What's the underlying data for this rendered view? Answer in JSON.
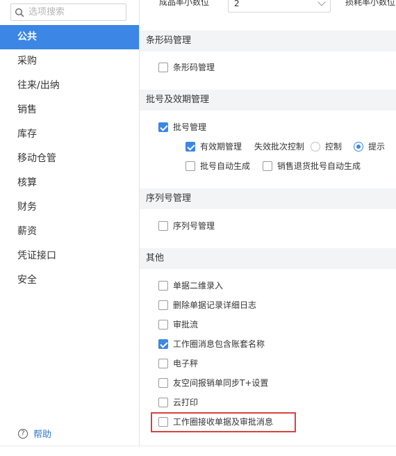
{
  "search": {
    "placeholder": "选项搜索"
  },
  "sidebar": {
    "items": [
      {
        "label": "公共"
      },
      {
        "label": "采购"
      },
      {
        "label": "往来/出纳"
      },
      {
        "label": "销售"
      },
      {
        "label": "库存"
      },
      {
        "label": "移动仓管"
      },
      {
        "label": "核算"
      },
      {
        "label": "财务"
      },
      {
        "label": "薪资"
      },
      {
        "label": "凭证接口"
      },
      {
        "label": "安全"
      }
    ],
    "active": "公共",
    "help_label": "帮助"
  },
  "top_row": {
    "label1": "成品率小数位",
    "select_value": "2",
    "label2": "损耗率小数位"
  },
  "sections": {
    "barcode": {
      "title": "条形码管理",
      "items": [
        {
          "label": "条形码管理",
          "checked": false
        }
      ]
    },
    "batch": {
      "title": "批号及效期管理",
      "batch_mgmt": {
        "label": "批号管理",
        "checked": true
      },
      "expiry": {
        "label": "有效期管理",
        "checked": true
      },
      "expired_ctrl_label": "失效批次控制",
      "radio_control": {
        "label": "控制",
        "checked": false
      },
      "radio_prompt": {
        "label": "提示",
        "checked": true
      },
      "auto_gen": {
        "label": "批号自动生成",
        "checked": false
      },
      "return_auto_gen": {
        "label": "销售退货批号自动生成",
        "checked": false
      }
    },
    "serial": {
      "title": "序列号管理",
      "items": [
        {
          "label": "序列号管理",
          "checked": false
        }
      ]
    },
    "other": {
      "title": "其他",
      "items": [
        {
          "label": "单据二维录入",
          "checked": false
        },
        {
          "label": "删除单据记录详细日志",
          "checked": false
        },
        {
          "label": "审批流",
          "checked": false
        },
        {
          "label": "工作圈消息包含账套名称",
          "checked": true
        },
        {
          "label": "电子秤",
          "checked": false
        },
        {
          "label": "友空间报销单同步T+设置",
          "checked": false
        },
        {
          "label": "云打印",
          "checked": false
        },
        {
          "label": "工作圈接收单据及审批消息",
          "checked": false
        }
      ]
    }
  },
  "colors": {
    "accent": "#3c86e5",
    "highlight": "#d9413c",
    "section_bg": "#f3f4f6"
  },
  "icons": {
    "search": "search-icon",
    "help": "help-circle-icon",
    "dropdown": "chevron-down-icon"
  }
}
